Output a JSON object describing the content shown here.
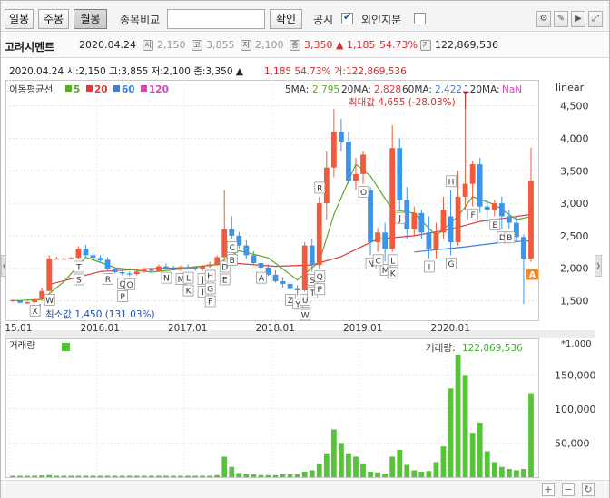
{
  "toolbar": {
    "period_buttons": [
      "일봉",
      "주봉",
      "월봉"
    ],
    "active_period": "월봉",
    "compare_label": "종목비교",
    "compare_value": "",
    "confirm_label": "확인",
    "disclosure_label": "공시",
    "disclosure_checked": true,
    "foreign_label": "외인지분",
    "foreign_checked": false
  },
  "infobar": {
    "name": "고려시멘트",
    "date": "2020.04.24",
    "open": "2,150",
    "high": "3,855",
    "low": "2,100",
    "close": "3,350",
    "change": "▲ 1,185",
    "change_pct": "54.73%",
    "volume": "122,869,536"
  },
  "chart_data": {
    "type": "candlestick",
    "period": "monthly",
    "header_line": "2020.04.24 시:2,150 고:3,855 저:2,100 종:3,350 ▲",
    "header_change": "1,185 54.73% 거:122,869,536",
    "ma_legend_title": "이동평균선",
    "ma_legend": [
      {
        "label": "5",
        "color": "#5aaa2a"
      },
      {
        "label": "20",
        "color": "#e03a3a"
      },
      {
        "label": "60",
        "color": "#3a7ee0"
      },
      {
        "label": "120",
        "color": "#e040c0"
      }
    ],
    "ma_values": [
      {
        "label": "5MA:",
        "value": "2,795",
        "color": "#5aaa2a"
      },
      {
        "label": "20MA:",
        "value": "2,828",
        "color": "#e03a3a"
      },
      {
        "label": "60MA:",
        "value": "2,422",
        "color": "#3a7ee0"
      },
      {
        "label": "120MA:",
        "value": "NaN",
        "color": "#e040c0"
      }
    ],
    "scale_label": "linear",
    "ylim": [
      1200,
      4900
    ],
    "y_ticks": [
      "4,500",
      "4,000",
      "3,500",
      "3,000",
      "2,500",
      "2,000",
      "1,500"
    ],
    "y_tick_values": [
      4500,
      4000,
      3500,
      3000,
      2500,
      2000,
      1500
    ],
    "x_ticks": [
      "2015.01",
      "2016.01",
      "2017.01",
      "2018.01",
      "2019.01",
      "2020.01"
    ],
    "max_label": "최대값 4,655 (-28.03%)",
    "min_label": "최소값 1,450 (131.03%)",
    "close_marker": "A",
    "candles": [
      {
        "o": 1500,
        "h": 1520,
        "l": 1480,
        "c": 1510
      },
      {
        "o": 1500,
        "h": 1510,
        "l": 1460,
        "c": 1470
      },
      {
        "o": 1460,
        "h": 1490,
        "l": 1450,
        "c": 1480
      },
      {
        "o": 1480,
        "h": 1540,
        "l": 1470,
        "c": 1520
      },
      {
        "o": 1520,
        "h": 1700,
        "l": 1500,
        "c": 1650
      },
      {
        "o": 1650,
        "h": 2200,
        "l": 1640,
        "c": 2150
      },
      {
        "o": 2150,
        "h": 2180,
        "l": 2140,
        "c": 2150
      },
      {
        "o": 2150,
        "h": 2160,
        "l": 2140,
        "c": 2150
      },
      {
        "o": 2150,
        "h": 2170,
        "l": 2140,
        "c": 2160
      },
      {
        "o": 2160,
        "h": 2340,
        "l": 2150,
        "c": 2300
      },
      {
        "o": 2300,
        "h": 2360,
        "l": 2180,
        "c": 2200
      },
      {
        "o": 2200,
        "h": 2240,
        "l": 2150,
        "c": 2160
      },
      {
        "o": 2160,
        "h": 2200,
        "l": 2090,
        "c": 2120
      },
      {
        "o": 2130,
        "h": 2170,
        "l": 1960,
        "c": 1990
      },
      {
        "o": 1990,
        "h": 2010,
        "l": 1920,
        "c": 1940
      },
      {
        "o": 1940,
        "h": 1960,
        "l": 1890,
        "c": 1920
      },
      {
        "o": 1920,
        "h": 1950,
        "l": 1880,
        "c": 1910
      },
      {
        "o": 1910,
        "h": 1960,
        "l": 1890,
        "c": 1950
      },
      {
        "o": 1950,
        "h": 2000,
        "l": 1930,
        "c": 1980
      },
      {
        "o": 1980,
        "h": 2010,
        "l": 1940,
        "c": 1960
      },
      {
        "o": 1960,
        "h": 2060,
        "l": 1950,
        "c": 2030
      },
      {
        "o": 2030,
        "h": 2070,
        "l": 1980,
        "c": 2000
      },
      {
        "o": 2000,
        "h": 2040,
        "l": 1970,
        "c": 1990
      },
      {
        "o": 1990,
        "h": 2040,
        "l": 1960,
        "c": 2020
      },
      {
        "o": 2020,
        "h": 2060,
        "l": 1980,
        "c": 2010
      },
      {
        "o": 2010,
        "h": 2030,
        "l": 1960,
        "c": 1990
      },
      {
        "o": 1990,
        "h": 2050,
        "l": 1960,
        "c": 2030
      },
      {
        "o": 2030,
        "h": 2100,
        "l": 2010,
        "c": 2060
      },
      {
        "o": 2060,
        "h": 2200,
        "l": 2040,
        "c": 2170
      },
      {
        "o": 2170,
        "h": 3200,
        "l": 2150,
        "c": 2600
      },
      {
        "o": 2600,
        "h": 2800,
        "l": 2450,
        "c": 2500
      },
      {
        "o": 2500,
        "h": 2560,
        "l": 2300,
        "c": 2350
      },
      {
        "o": 2350,
        "h": 2430,
        "l": 2150,
        "c": 2200
      },
      {
        "o": 2200,
        "h": 2260,
        "l": 2050,
        "c": 2080
      },
      {
        "o": 2080,
        "h": 2140,
        "l": 1980,
        "c": 2010
      },
      {
        "o": 2010,
        "h": 2060,
        "l": 1880,
        "c": 1900
      },
      {
        "o": 1900,
        "h": 1970,
        "l": 1780,
        "c": 1800
      },
      {
        "o": 1800,
        "h": 1860,
        "l": 1700,
        "c": 1760
      },
      {
        "o": 1760,
        "h": 1790,
        "l": 1640,
        "c": 1680
      },
      {
        "o": 1680,
        "h": 1740,
        "l": 1580,
        "c": 1660
      },
      {
        "o": 1660,
        "h": 2400,
        "l": 1640,
        "c": 2350
      },
      {
        "o": 2350,
        "h": 2450,
        "l": 1950,
        "c": 2050
      },
      {
        "o": 2050,
        "h": 3100,
        "l": 2000,
        "c": 3000
      },
      {
        "o": 3000,
        "h": 3800,
        "l": 2750,
        "c": 3550
      },
      {
        "o": 3550,
        "h": 4450,
        "l": 3400,
        "c": 4100
      },
      {
        "o": 4100,
        "h": 4300,
        "l": 3800,
        "c": 3950
      },
      {
        "o": 3950,
        "h": 4100,
        "l": 3300,
        "c": 3350
      },
      {
        "o": 3350,
        "h": 3700,
        "l": 3200,
        "c": 3450
      },
      {
        "o": 3450,
        "h": 3800,
        "l": 3300,
        "c": 3750
      },
      {
        "o": 3200,
        "h": 3250,
        "l": 2200,
        "c": 2400
      },
      {
        "o": 2400,
        "h": 2620,
        "l": 2250,
        "c": 2550
      },
      {
        "o": 2550,
        "h": 2700,
        "l": 2100,
        "c": 2300
      },
      {
        "o": 2300,
        "h": 4200,
        "l": 2250,
        "c": 3850
      },
      {
        "o": 3850,
        "h": 4000,
        "l": 2900,
        "c": 3050
      },
      {
        "o": 3050,
        "h": 3250,
        "l": 2450,
        "c": 2600
      },
      {
        "o": 2600,
        "h": 2950,
        "l": 2500,
        "c": 2850
      },
      {
        "o": 2850,
        "h": 2900,
        "l": 2450,
        "c": 2550
      },
      {
        "o": 2550,
        "h": 2800,
        "l": 2150,
        "c": 2300
      },
      {
        "o": 2300,
        "h": 2700,
        "l": 2150,
        "c": 2550
      },
      {
        "o": 2550,
        "h": 3100,
        "l": 2450,
        "c": 2900
      },
      {
        "o": 2800,
        "h": 3200,
        "l": 2200,
        "c": 2400
      },
      {
        "o": 2400,
        "h": 3500,
        "l": 2350,
        "c": 3100
      },
      {
        "o": 3100,
        "h": 4655,
        "l": 2900,
        "c": 3300
      },
      {
        "o": 3300,
        "h": 3650,
        "l": 2950,
        "c": 3600
      },
      {
        "o": 3600,
        "h": 3700,
        "l": 2850,
        "c": 2950
      },
      {
        "o": 2950,
        "h": 3050,
        "l": 2700,
        "c": 2900
      },
      {
        "o": 2900,
        "h": 3050,
        "l": 2800,
        "c": 3000
      },
      {
        "o": 3000,
        "h": 3100,
        "l": 2600,
        "c": 2800
      },
      {
        "o": 2800,
        "h": 2900,
        "l": 2600,
        "c": 2700
      },
      {
        "o": 2700,
        "h": 2800,
        "l": 2400,
        "c": 2480
      },
      {
        "o": 2480,
        "h": 2520,
        "l": 1450,
        "c": 2150
      },
      {
        "o": 2150,
        "h": 3855,
        "l": 2100,
        "c": 3350
      }
    ],
    "ma5": [
      [
        0,
        1500
      ],
      [
        4,
        1520
      ],
      [
        7,
        1790
      ],
      [
        10,
        2170
      ],
      [
        14,
        2010
      ],
      [
        19,
        1940
      ],
      [
        24,
        2000
      ],
      [
        28,
        2060
      ],
      [
        31,
        2270
      ],
      [
        35,
        2160
      ],
      [
        39,
        1820
      ],
      [
        42,
        2100
      ],
      [
        44,
        2830
      ],
      [
        47,
        3600
      ],
      [
        49,
        3420
      ],
      [
        52,
        2900
      ],
      [
        55,
        2850
      ],
      [
        58,
        2500
      ],
      [
        61,
        2800
      ],
      [
        63,
        3100
      ],
      [
        66,
        2980
      ],
      [
        69,
        2750
      ],
      [
        71,
        2795
      ]
    ],
    "ma20": [
      [
        5,
        1750
      ],
      [
        12,
        1950
      ],
      [
        18,
        1990
      ],
      [
        24,
        2010
      ],
      [
        30,
        2080
      ],
      [
        36,
        2030
      ],
      [
        41,
        2050
      ],
      [
        45,
        2180
      ],
      [
        50,
        2450
      ],
      [
        55,
        2500
      ],
      [
        60,
        2600
      ],
      [
        64,
        2720
      ],
      [
        68,
        2780
      ],
      [
        71,
        2828
      ]
    ],
    "ma60": [
      [
        55,
        2250
      ],
      [
        62,
        2330
      ],
      [
        67,
        2400
      ],
      [
        71,
        2422
      ]
    ],
    "markers": [
      {
        "i": 3,
        "t": "X"
      },
      {
        "i": 5,
        "t": "W"
      },
      {
        "i": 9,
        "t": "T"
      },
      {
        "i": 9,
        "t": "S",
        "r": 1
      },
      {
        "i": 13,
        "t": "R"
      },
      {
        "i": 15,
        "t": "Q"
      },
      {
        "i": 16,
        "t": "O"
      },
      {
        "i": 15,
        "t": "P",
        "r": 1
      },
      {
        "i": 21,
        "t": "N"
      },
      {
        "i": 23,
        "t": "M"
      },
      {
        "i": 24,
        "t": "L"
      },
      {
        "i": 24,
        "t": "K",
        "r": 1
      },
      {
        "i": 26,
        "t": "J"
      },
      {
        "i": 27,
        "t": "H"
      },
      {
        "i": 26,
        "t": "I",
        "r": 1
      },
      {
        "i": 27,
        "t": "G",
        "r": 1
      },
      {
        "i": 27,
        "t": "F",
        "r": 2
      },
      {
        "i": 29,
        "t": "D"
      },
      {
        "i": 30,
        "t": "C"
      },
      {
        "i": 29,
        "t": "E",
        "r": 1
      },
      {
        "i": 30,
        "t": "B",
        "r": 1
      },
      {
        "i": 34,
        "t": "A"
      },
      {
        "i": 38,
        "t": "Z"
      },
      {
        "i": 39,
        "t": "Y"
      },
      {
        "i": 40,
        "t": "X",
        "r": 1
      },
      {
        "i": 40,
        "t": "W",
        "r": 2
      },
      {
        "i": 40,
        "t": "U"
      },
      {
        "i": 41,
        "t": "V"
      },
      {
        "i": 41,
        "t": "T",
        "r": 1
      },
      {
        "i": 41,
        "t": "S"
      },
      {
        "i": 42,
        "t": "R",
        "a": 1
      },
      {
        "i": 42,
        "t": "Q"
      },
      {
        "i": 42,
        "t": "P",
        "r": 1
      },
      {
        "i": 48,
        "t": "O"
      },
      {
        "i": 49,
        "t": "N"
      },
      {
        "i": 51,
        "t": "M"
      },
      {
        "i": 50,
        "t": "C"
      },
      {
        "i": 52,
        "t": "L"
      },
      {
        "i": 52,
        "t": "K",
        "r": 1
      },
      {
        "i": 53,
        "t": "J"
      },
      {
        "i": 57,
        "t": "I"
      },
      {
        "i": 60,
        "t": "H",
        "a": 1
      },
      {
        "i": 60,
        "t": "G"
      },
      {
        "i": 63,
        "t": "F"
      },
      {
        "i": 66,
        "t": "E"
      },
      {
        "i": 67,
        "t": "D"
      },
      {
        "i": 68,
        "t": "B"
      }
    ],
    "volume": {
      "title": "거래량",
      "unit": "*1,000",
      "legend_label": "거래량:",
      "legend_value": "122,869,536",
      "ylim": [
        0,
        185000
      ],
      "y_ticks": [
        "150,000",
        "100,000",
        "50,000"
      ],
      "y_tick_values": [
        150000,
        100000,
        50000
      ],
      "values": [
        2000,
        2000,
        2000,
        2000,
        2500,
        3000,
        2000,
        2000,
        2000,
        2000,
        2000,
        2000,
        2000,
        2000,
        2000,
        2000,
        2000,
        2000,
        2000,
        2000,
        2000,
        2000,
        2000,
        2000,
        2000,
        2000,
        2000,
        2000,
        3000,
        30000,
        15000,
        6000,
        5000,
        4000,
        3000,
        3000,
        3000,
        4000,
        4000,
        4000,
        8000,
        10000,
        20000,
        35000,
        70000,
        50000,
        35000,
        30000,
        20000,
        8000,
        7000,
        5000,
        30000,
        40000,
        18000,
        10000,
        8000,
        9000,
        22000,
        45000,
        130000,
        180000,
        150000,
        65000,
        80000,
        38000,
        22000,
        15000,
        12000,
        10000,
        12000,
        123000
      ]
    }
  }
}
